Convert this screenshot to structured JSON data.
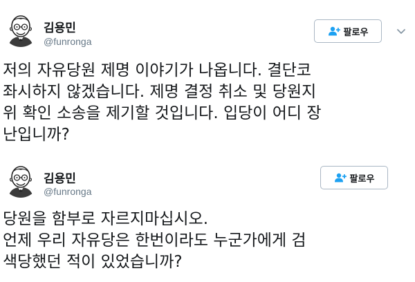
{
  "colors": {
    "text": "#14171a",
    "handle": "#657786",
    "follow_icon": "#1da1f2",
    "button_border": "#a9b6c3"
  },
  "tweets": [
    {
      "name": "김용민",
      "handle": "@funronga",
      "follow_label": "팔로우",
      "follow_icon": "add-user-icon",
      "has_menu": true,
      "lines": [
        "저의 자유당원 제명 이야기가 나옵니다. 결단코",
        "좌시하지 않겠습니다. 제명 결정 취소 및 당원지",
        "위 확인 소송을 제기할 것입니다. 입당이 어디 장",
        "난입니까?"
      ]
    },
    {
      "name": "김용민",
      "handle": "@funronga",
      "follow_label": "팔로우",
      "follow_icon": "add-user-icon",
      "has_menu": false,
      "lines": [
        "당원을 함부로 자르지마십시오.",
        "언제 우리 자유당은 한번이라도 누군가에게 검",
        "색당했던 적이 있었습니까?"
      ]
    }
  ]
}
